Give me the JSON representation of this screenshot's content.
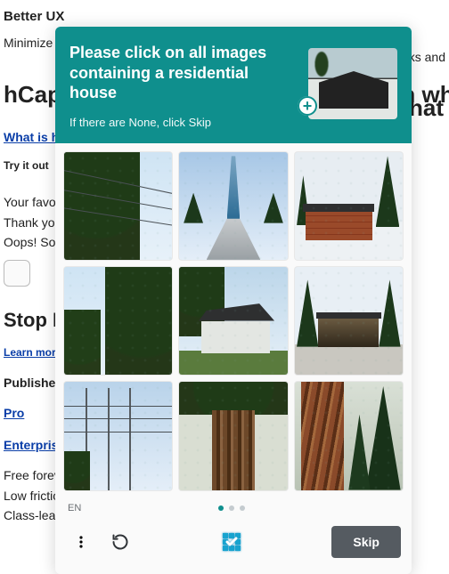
{
  "background": {
    "h3_a": "Better UX",
    "p_a": "Minimize frustration and risks and bots",
    "h1": "hCaptcha — Stop more bots. Start on what matters.",
    "link_what": "What is hCaptcha?",
    "tryit": "Try it out",
    "fav": "Your favorite color",
    "thank": "Thank you",
    "oops": "Oops! Something went wrong",
    "h2": "Stop Bad Bots",
    "learn": "Learn more",
    "pub": "Publishers",
    "pro": "Pro",
    "ent": "Enterprise",
    "free": "Free forever",
    "fric": "Low friction",
    "ml": "Class-leading security ML, threat scores, and more",
    "right_1": "sks and",
    "right_nw": "on what"
  },
  "captcha": {
    "prompt_line_a": "Please click on all images",
    "prompt_line_b": "containing a residential house",
    "none_hint": "If there are None, click Skip",
    "tiles": [
      {
        "id": 1,
        "scene": "powerlines-tree",
        "desc": "Tree leaves with power lines against blue sky"
      },
      {
        "id": 2,
        "scene": "skyscraper",
        "desc": "Tall glass tower with road leading to it"
      },
      {
        "id": 3,
        "scene": "brick-house-snow",
        "desc": "Single-story brick house with snow and pines"
      },
      {
        "id": 4,
        "scene": "tree-sky",
        "desc": "Close-up tree foliage against sky"
      },
      {
        "id": 5,
        "scene": "modern-house",
        "desc": "Modern flat-roof house with lawn and tree"
      },
      {
        "id": 6,
        "scene": "glass-house",
        "desc": "Glass box house among trees on concrete"
      },
      {
        "id": 7,
        "scene": "pylons",
        "desc": "Electricity pylons and wires against sky"
      },
      {
        "id": 8,
        "scene": "trunk",
        "desc": "Close-up of a large tree trunk with foliage top"
      },
      {
        "id": 9,
        "scene": "redwood",
        "desc": "Redwood trunk among conifers"
      }
    ],
    "lang": "EN",
    "page_dots": 3,
    "active_dot": 0,
    "skip_label": "Skip"
  }
}
